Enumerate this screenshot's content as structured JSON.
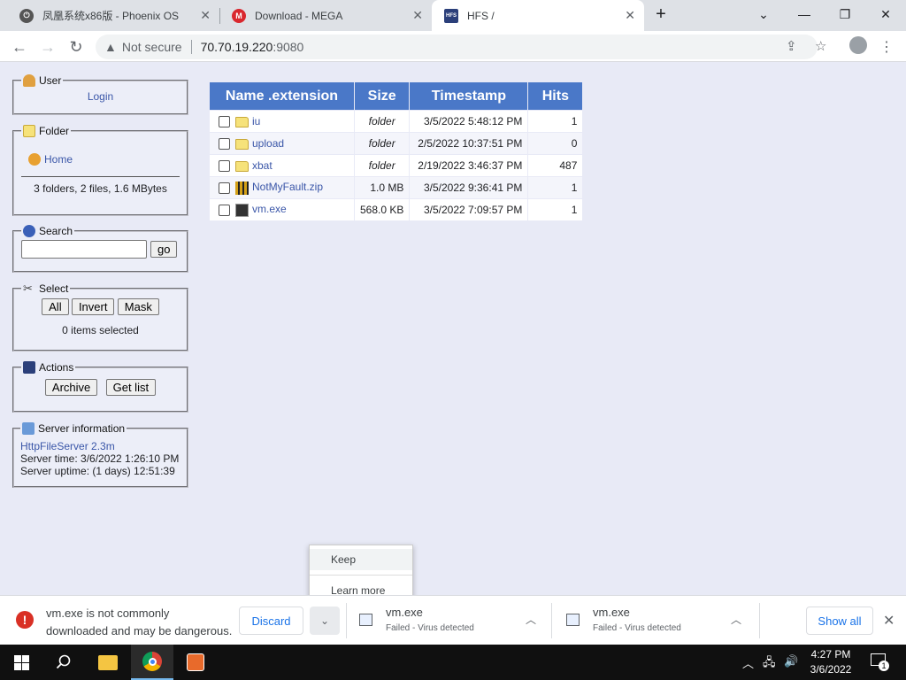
{
  "browser": {
    "tabs": [
      {
        "title": "凤凰系统x86版 - Phoenix OS",
        "favicon_color": "#555555"
      },
      {
        "title": "Download - MEGA",
        "favicon_color": "#d9272e",
        "favicon_glyph": "M"
      },
      {
        "title": "HFS /",
        "favicon_color": "#2b3f7a",
        "favicon_glyph": "HFS"
      }
    ],
    "new_tab_glyph": "+",
    "address": {
      "security_label": "Not secure",
      "host": "70.70.19.220",
      "port": ":9080"
    }
  },
  "sidebar": {
    "user": {
      "legend": "User",
      "login_link": "Login"
    },
    "folder": {
      "legend": "Folder",
      "home_link": "Home",
      "summary": "3 folders, 2 files, 1.6 MBytes"
    },
    "search": {
      "legend": "Search",
      "input_value": "",
      "go_label": "go"
    },
    "select": {
      "legend": "Select",
      "all_label": "All",
      "invert_label": "Invert",
      "mask_label": "Mask",
      "status": "0 items selected"
    },
    "actions": {
      "legend": "Actions",
      "archive_label": "Archive",
      "getlist_label": "Get list"
    },
    "server": {
      "legend": "Server information",
      "software_link": "HttpFileServer 2.3m",
      "server_time": "Server time: 3/6/2022 1:26:10 PM",
      "server_uptime": "Server uptime: (1 days) 12:51:39"
    }
  },
  "filetable": {
    "headers": [
      "Name .extension",
      "Size",
      "Timestamp",
      "Hits"
    ],
    "rows": [
      {
        "name": "iu",
        "type": "folder",
        "size": "folder",
        "timestamp": "3/5/2022 5:48:12 PM",
        "hits": "1"
      },
      {
        "name": "upload",
        "type": "folder",
        "size": "folder",
        "timestamp": "2/5/2022 10:37:51 PM",
        "hits": "0"
      },
      {
        "name": "xbat",
        "type": "folder",
        "size": "folder",
        "timestamp": "2/19/2022 3:46:37 PM",
        "hits": "487"
      },
      {
        "name": "NotMyFault.zip",
        "type": "zip",
        "size": "1.0 MB",
        "timestamp": "3/5/2022 9:36:41 PM",
        "hits": "1"
      },
      {
        "name": "vm.exe",
        "type": "exe",
        "size": "568.0 KB",
        "timestamp": "3/5/2022 7:09:57 PM",
        "hits": "1"
      }
    ]
  },
  "download_menu": {
    "keep": "Keep",
    "learn_more": "Learn more"
  },
  "shelf": {
    "warning_line1": "vm.exe is not commonly",
    "warning_line2": "downloaded and may be dangerous.",
    "discard": "Discard",
    "items": [
      {
        "name": "vm.exe",
        "status": "Failed - Virus detected"
      },
      {
        "name": "vm.exe",
        "status": "Failed - Virus detected"
      }
    ],
    "show_all": "Show all"
  },
  "taskbar": {
    "time": "4:27 PM",
    "date": "3/6/2022",
    "notification_count": "1"
  }
}
